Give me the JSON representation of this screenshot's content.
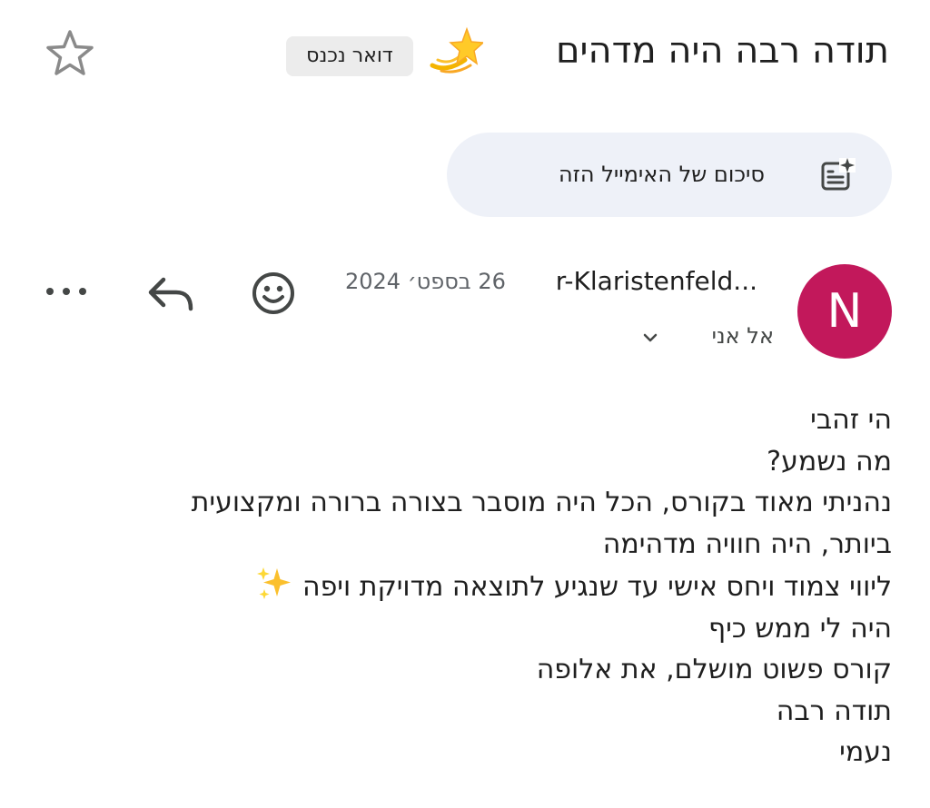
{
  "header": {
    "subject": "תודה רבה היה מדהים",
    "subject_emoji": "shooting-star-icon",
    "label_chip": "דואר נכנס",
    "star_icon": "star-outline-icon"
  },
  "summary": {
    "label": "סיכום של האימייל הזה",
    "icon": "summarize-sparkle-icon"
  },
  "message": {
    "avatar_letter": "N",
    "avatar_color": "#c2185b",
    "sender": "r-Klaristenfeld...",
    "date": "26 בספט׳ 2024",
    "recipient": "אל אני",
    "actions": [
      "smiley-icon",
      "reply-icon",
      "more-icon"
    ]
  },
  "body": {
    "lines": [
      "הי זהבי",
      "מה נשמע?",
      "נהניתי מאוד בקורס, הכל היה מוסבר בצורה ברורה ומקצועית",
      "ביותר, היה חוויה מדהימה",
      "ליווי צמוד ויחס אישי עד שנגיע לתוצאה מדויקת ויפה",
      "היה לי ממש כיף",
      "קורס פשוט מושלם, את אלופה",
      "תודה רבה",
      "נעמי"
    ]
  }
}
